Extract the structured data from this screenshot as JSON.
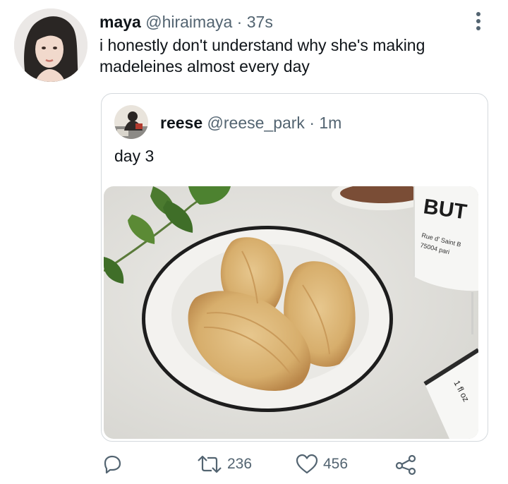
{
  "tweet": {
    "author_name": "maya",
    "handle": "@hiraimaya",
    "separator": "·",
    "time": "37s",
    "text": "i honestly don't understand why she's making madeleines almost every day"
  },
  "quoted_tweet": {
    "author_name": "reese",
    "handle": "@reese_park",
    "separator": "·",
    "time": "1m",
    "text": "day 3",
    "image": {
      "box_text": "BUT",
      "box_address_line1": "Rue d' Saint B",
      "box_address_line2": "75004 pari",
      "bottle_label": "1 fl oz"
    }
  },
  "actions": {
    "reply_icon": "reply-icon",
    "retweet_icon": "retweet-icon",
    "retweet_count": "236",
    "like_icon": "heart-icon",
    "like_count": "456",
    "share_icon": "share-icon"
  },
  "colors": {
    "text": "#0f1419",
    "secondary": "#536471",
    "border": "#d4d9dd"
  }
}
